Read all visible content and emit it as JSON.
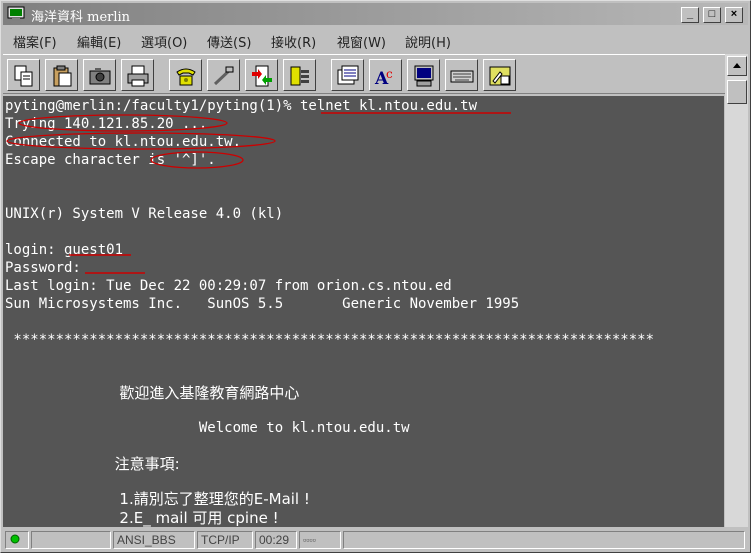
{
  "window": {
    "title": "海洋資科 merlin"
  },
  "menu": [
    {
      "label": "檔案(F)"
    },
    {
      "label": "編輯(E)"
    },
    {
      "label": "選項(O)"
    },
    {
      "label": "傳送(S)"
    },
    {
      "label": "接收(R)"
    },
    {
      "label": "視窗(W)"
    },
    {
      "label": "說明(H)"
    }
  ],
  "toolbar": [
    {
      "icon": "copy-icon"
    },
    {
      "icon": "paste-icon"
    },
    {
      "icon": "camera-icon"
    },
    {
      "icon": "print-icon"
    },
    {
      "icon": "phone-icon"
    },
    {
      "icon": "disconnect-icon"
    },
    {
      "icon": "transfer-icon"
    },
    {
      "icon": "settings-icon"
    },
    {
      "icon": "session-icon"
    },
    {
      "icon": "font-icon"
    },
    {
      "icon": "terminal-icon"
    },
    {
      "icon": "keyboard-icon"
    },
    {
      "icon": "script-icon"
    }
  ],
  "terminal": {
    "lines": [
      "pyting@merlin:/faculty1/pyting(1)% telnet kl.ntou.edu.tw",
      "Trying 140.121.85.20 ...",
      "Connected to kl.ntou.edu.tw.",
      "Escape character is '^]'.",
      "",
      "",
      "UNIX(r) System V Release 4.0 (kl)",
      "",
      "login: guest01",
      "Password:",
      "Last login: Tue Dec 22 00:29:07 from orion.cs.ntou.ed",
      "Sun Microsystems Inc.   SunOS 5.5       Generic November 1995",
      "",
      " ****************************************************************************",
      "",
      "",
      "                        歡迎進入基隆教育網路中心",
      "",
      "                       Welcome to kl.ntou.edu.tw",
      "",
      "                       注意事項:",
      "",
      "                        1.請別忘了整理您的E-Mail !",
      "                        2.E_ mail 可用 cpine !"
    ]
  },
  "status": {
    "emulation": "ANSI_BBS",
    "protocol": "TCP/IP",
    "time": "00:29",
    "leds": "▫▫▫▫"
  },
  "colors": {
    "terminal_bg": "#555555",
    "terminal_fg": "#ffffff",
    "annotation": "#cc0000"
  }
}
